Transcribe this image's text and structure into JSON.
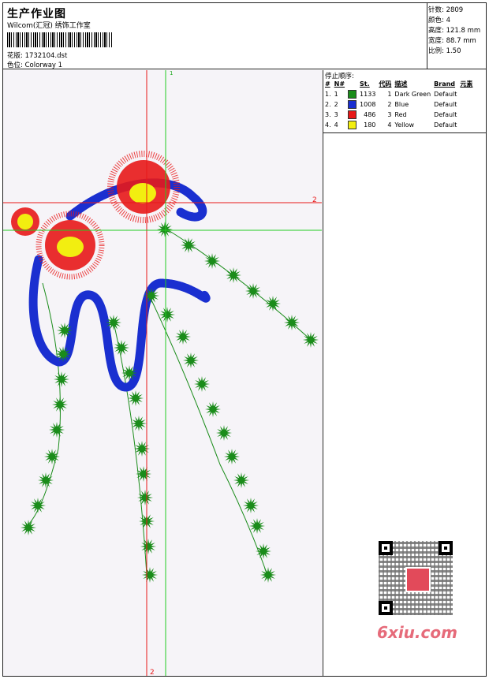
{
  "header": {
    "title": "生产作业图",
    "subtitle": "Wilcom(汇冠) 绣饰工作室",
    "design_line": "花版: 1732104.dst",
    "colorway_line": "色位: Colorway 1"
  },
  "stats": {
    "stitches": "针数: 2809",
    "colors": "颜色: 4",
    "height": "高度: 121.8 mm",
    "width": "宽度: 88.7 mm",
    "ratio": "比例: 1.50"
  },
  "stop_sequence": {
    "label": "停止顺序:",
    "columns": [
      "#",
      "N#",
      "St.",
      "代码",
      "描述",
      "Brand",
      "元素"
    ],
    "rows": [
      {
        "idx": "1.",
        "n": "1",
        "st": "1133",
        "code": "1",
        "desc": "Dark Green",
        "brand": "Default",
        "color": "#1a8c1a"
      },
      {
        "idx": "2.",
        "n": "2",
        "st": "1008",
        "code": "2",
        "desc": "Blue",
        "brand": "Default",
        "color": "#1a2fd0"
      },
      {
        "idx": "3.",
        "n": "3",
        "st": "486",
        "code": "3",
        "desc": "Red",
        "brand": "Default",
        "color": "#e81818"
      },
      {
        "idx": "4.",
        "n": "4",
        "st": "180",
        "code": "4",
        "desc": "Yellow",
        "brand": "Default",
        "color": "#f2ee10"
      }
    ]
  },
  "guides": {
    "v_label_top": "1",
    "h_label_right": "2",
    "v_label_bottom": "2"
  },
  "watermark": "6xiu.com",
  "colors": {
    "green": "#1a8c1a",
    "blue": "#1a2fd0",
    "red": "#e81818",
    "yellow": "#f2ee10",
    "guide_red": "#e81818",
    "guide_green": "#22cc22"
  }
}
